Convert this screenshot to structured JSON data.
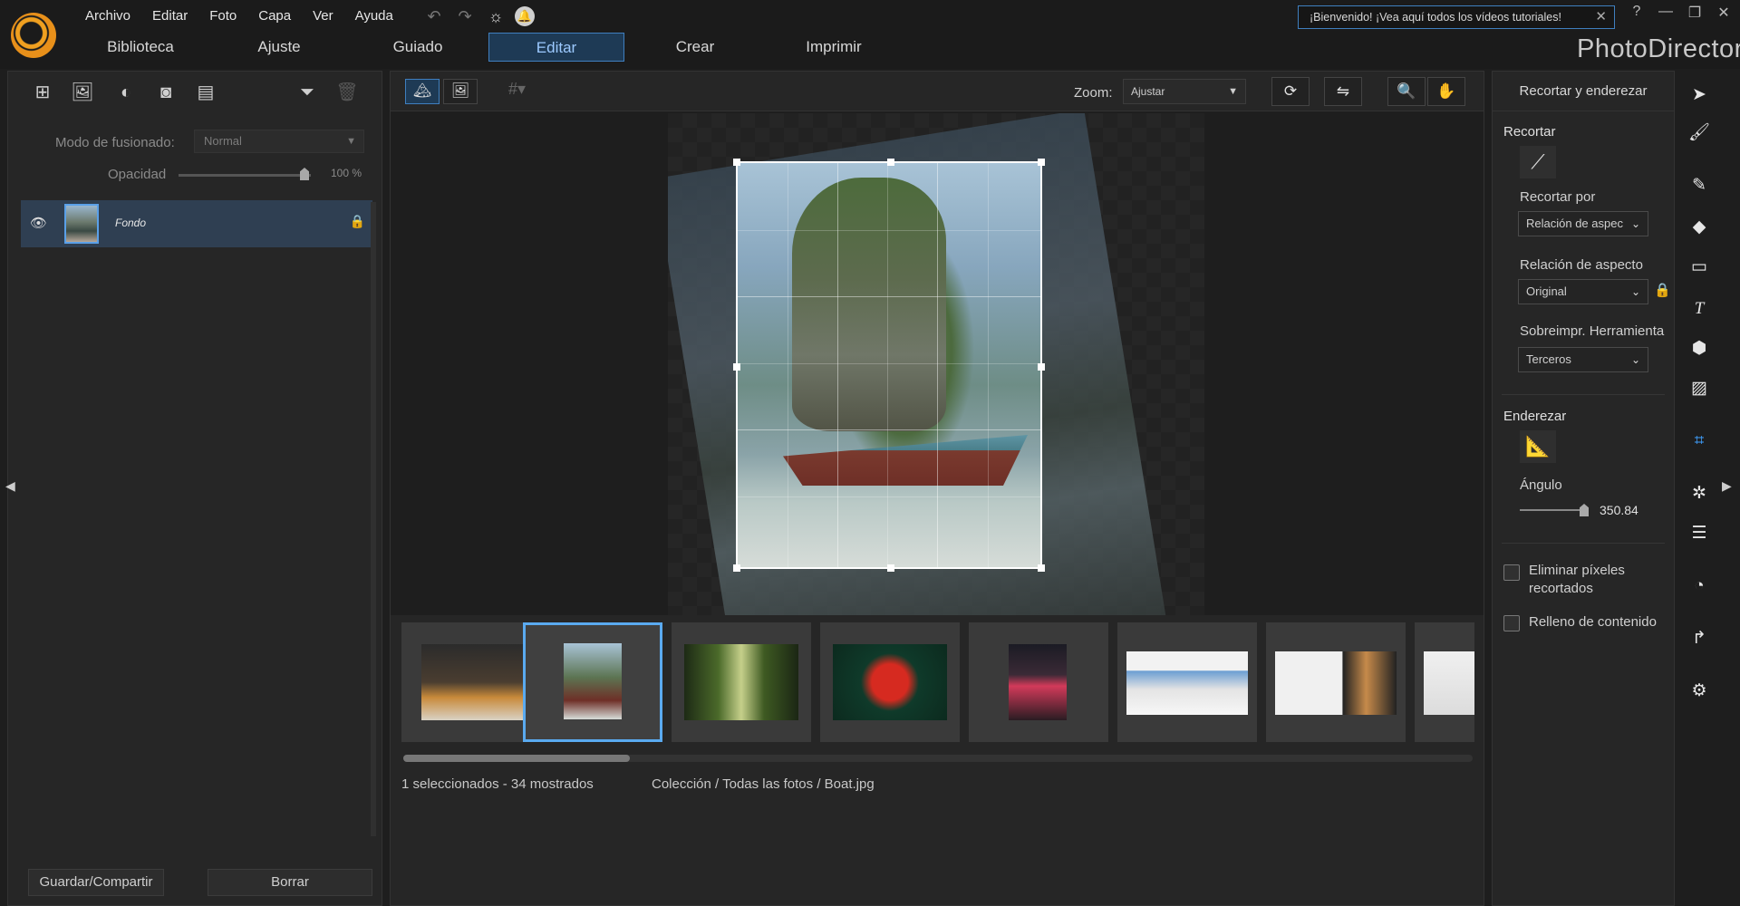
{
  "menu": [
    "Archivo",
    "Editar",
    "Foto",
    "Capa",
    "Ver",
    "Ayuda"
  ],
  "main_tabs": [
    {
      "label": "Biblioteca",
      "active": false
    },
    {
      "label": "Ajuste",
      "active": false
    },
    {
      "label": "Guiado",
      "active": false
    },
    {
      "label": "Editar",
      "active": true
    },
    {
      "label": "Crear",
      "active": false
    },
    {
      "label": "Imprimir",
      "active": false
    }
  ],
  "welcome": {
    "text": "¡Bienvenido! ¡Vea aquí todos los vídeos tutoriales!"
  },
  "brand": "PhotoDirector",
  "window_controls": [
    "?",
    "—",
    "❐",
    "✕"
  ],
  "layers_panel": {
    "blend_label": "Modo de fusionado:",
    "blend_value": "Normal",
    "opacity_label": "Opacidad",
    "opacity_value": "100 %",
    "opacity_fraction": 1.0,
    "layer_name": "Fondo",
    "save_button": "Guardar/Compartir",
    "delete_button": "Borrar"
  },
  "canvas_toolbar": {
    "zoom_label": "Zoom:",
    "zoom_value": "Ajustar"
  },
  "status": {
    "selection": "1 seleccionados - 34 mostrados",
    "path": "Colección / Todas las fotos / Boat.jpg"
  },
  "crop_panel": {
    "title": "Recortar y enderezar",
    "crop_section": "Recortar",
    "crop_by_label": "Recortar por",
    "crop_by_value": "Relación de aspec",
    "aspect_label": "Relación de aspecto",
    "aspect_value": "Original",
    "overlay_label": "Sobreimpr. Herramienta",
    "overlay_value": "Terceros",
    "straighten_section": "Enderezar",
    "angle_label": "Ángulo",
    "angle_value": "350.84",
    "remove_pixels": "Eliminar píxeles recortados",
    "content_fill": "Relleno de contenido"
  },
  "colors": {
    "accent": "#3f7fbf",
    "active_tab_bg": "#1e3a55",
    "selected_thumb": "#5aaaf0"
  }
}
